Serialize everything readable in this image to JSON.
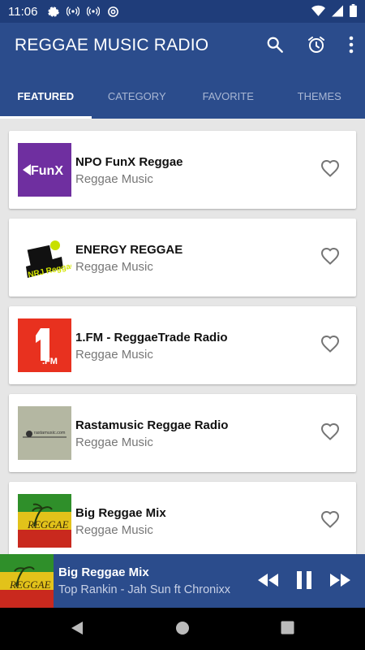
{
  "status": {
    "time": "11:06"
  },
  "app": {
    "title": "REGGAE MUSIC RADIO"
  },
  "tabs": [
    {
      "label": "FEATURED",
      "active": true
    },
    {
      "label": "CATEGORY",
      "active": false
    },
    {
      "label": "FAVORITE",
      "active": false
    },
    {
      "label": "THEMES",
      "active": false
    }
  ],
  "stations": [
    {
      "name": "NPO FunX Reggae",
      "genre": "Reggae Music",
      "logo_text": "FunX"
    },
    {
      "name": "ENERGY REGGAE",
      "genre": "Reggae Music",
      "logo_text": "NRJ Reggae"
    },
    {
      "name": "1.FM - ReggaeTrade Radio",
      "genre": "Reggae Music",
      "logo_text": ".FM"
    },
    {
      "name": "Rastamusic Reggae Radio",
      "genre": "Reggae Music",
      "logo_text": "rastamusic.com"
    },
    {
      "name": "Big Reggae Mix",
      "genre": "Reggae Music",
      "logo_text": "REGGAE"
    }
  ],
  "player": {
    "title": "Big Reggae Mix",
    "subtitle": "Top Rankin - Jah Sun ft Chronixx",
    "thumb_text": "REGGAE"
  },
  "colors": {
    "primary": "#2b4c8c",
    "status": "#1f3d7a"
  }
}
